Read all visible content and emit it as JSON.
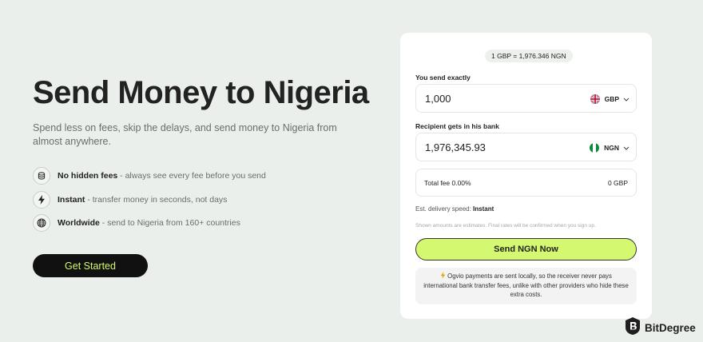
{
  "hero": {
    "title": "Send Money to Nigeria",
    "subtitle": "Spend less on fees, skip the delays, and send money to Nigeria from almost anywhere."
  },
  "features": [
    {
      "icon": "coins-icon",
      "title": "No hidden fees",
      "desc": " - always see every fee before you send"
    },
    {
      "icon": "bolt-icon",
      "title": "Instant",
      "desc": " - transfer money in seconds, not days"
    },
    {
      "icon": "globe-icon",
      "title": "Worldwide",
      "desc": " - send to Nigeria from 160+ countries"
    }
  ],
  "cta": {
    "label": "Get Started"
  },
  "converter": {
    "rate": "1 GBP = 1,976.346 NGN",
    "send_label": "You send exactly",
    "send_amount": "1,000",
    "send_currency": "GBP",
    "receive_label": "Recipient gets in his bank",
    "receive_amount": "1,976,345.93",
    "receive_currency": "NGN",
    "fee_label": "Total fee 0.00%",
    "fee_value": "0 GBP",
    "speed_label": "Est. delivery speed: ",
    "speed_value": "Instant",
    "note": "Shown amounts are estimates. Final rates will be confirmed when you sign up.",
    "send_button": "Send NGN Now",
    "info": "Ogvio payments are sent locally, so the receiver never pays international bank transfer fees, unlike with other providers who hide these extra costs."
  },
  "watermark": {
    "text": "BitDegree"
  },
  "colors": {
    "background": "#eaefec",
    "accent": "#d4f86f",
    "dark": "#111111",
    "card": "#ffffff"
  }
}
